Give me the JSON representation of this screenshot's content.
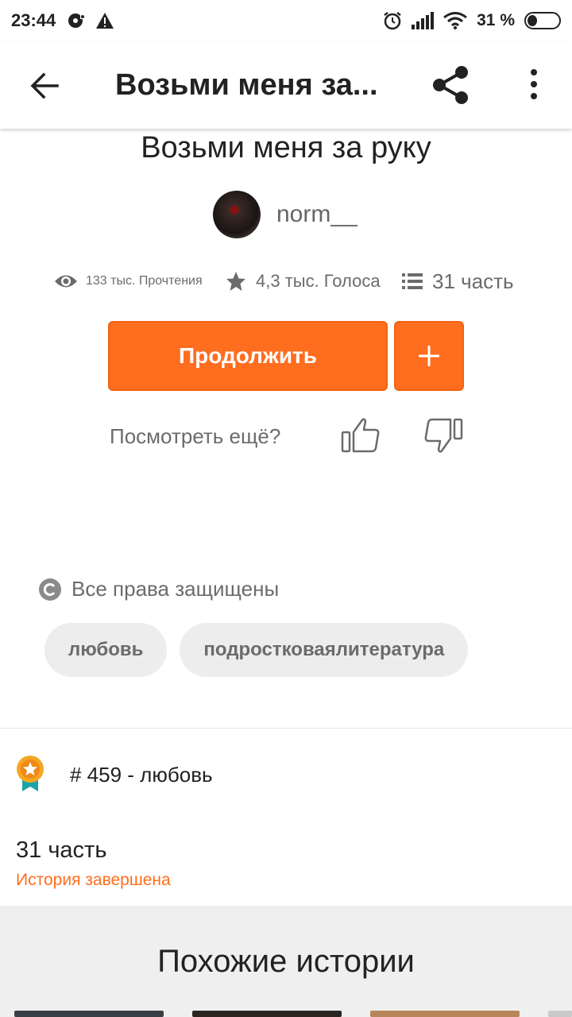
{
  "status_bar": {
    "time": "23:44",
    "battery": "31 %"
  },
  "app_bar": {
    "title": "Возьми меня за...",
    "icons": [
      "back-arrow-icon",
      "share-icon",
      "more-vert-icon"
    ]
  },
  "story": {
    "title": "Возьми меня за руку",
    "author": "norm__"
  },
  "stats": {
    "reads": "133 тыс. Прочтения",
    "votes": "4,3 тыс. Голоса",
    "parts": "31 часть"
  },
  "actions": {
    "continue_label": "Продолжить",
    "add_label": "+",
    "more_prompt": "Посмотреть ещё?"
  },
  "rights": "Все права защищены",
  "tags": [
    "любовь",
    "подростковаялитература"
  ],
  "rank": "# 459 - любовь",
  "parts_section": {
    "count": "31 часть",
    "status": "История завершена"
  },
  "similar": {
    "title": "Похожие истории"
  },
  "colors": {
    "accent": "#ff6d1f",
    "badge_gold": "#f6a623",
    "badge_teal": "#1aa3a8"
  }
}
